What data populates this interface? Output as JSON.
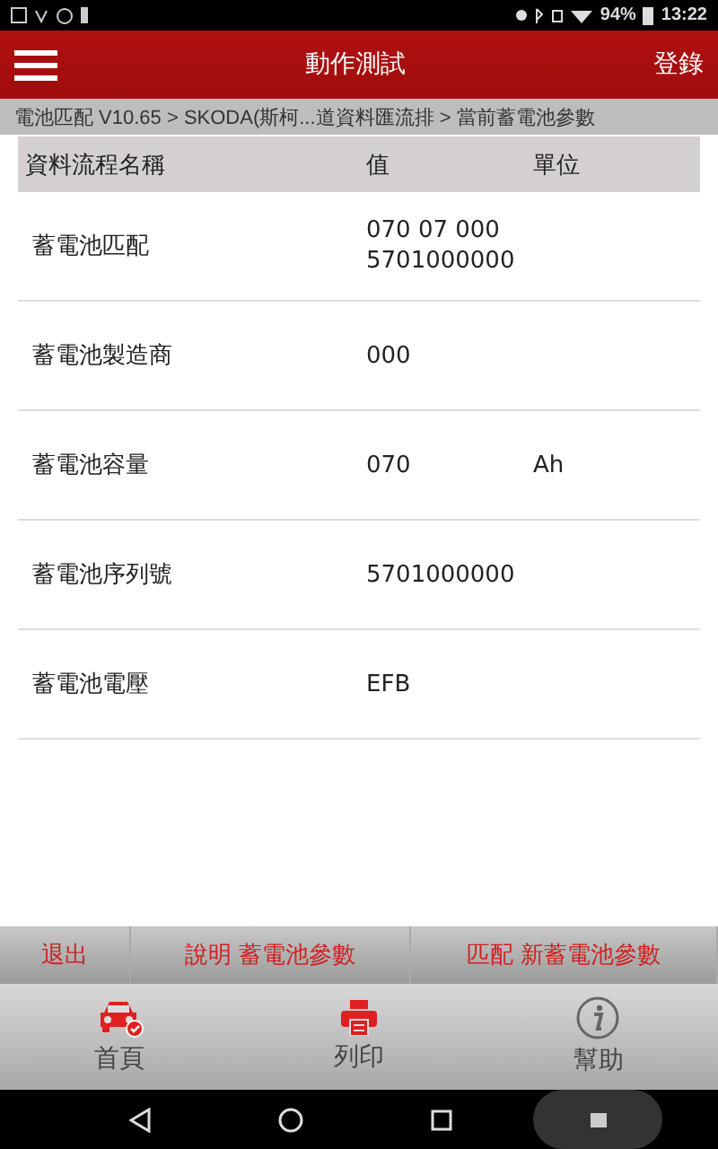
{
  "status_bar": {
    "battery": "94%",
    "time": "13:22"
  },
  "header": {
    "title": "動作測試",
    "action": "登錄"
  },
  "breadcrumb": "電池匹配 V10.65 > SKODA(斯柯...道資料匯流排 > 當前蓄電池參數",
  "table": {
    "columns": [
      "資料流程名稱",
      "值",
      "單位"
    ],
    "rows": [
      {
        "name": "蓄電池匹配",
        "value": [
          "070 07 000",
          "5701000000"
        ],
        "unit": ""
      },
      {
        "name": "蓄電池製造商",
        "value": [
          "000"
        ],
        "unit": ""
      },
      {
        "name": "蓄電池容量",
        "value": [
          "070"
        ],
        "unit": "Ah"
      },
      {
        "name": "蓄電池序列號",
        "value": [
          "5701000000"
        ],
        "unit": ""
      },
      {
        "name": "蓄電池電壓",
        "value": [
          "EFB"
        ],
        "unit": ""
      }
    ]
  },
  "actions": [
    "退出",
    "說明 蓄電池參數",
    "匹配 新蓄電池參數"
  ],
  "nav": [
    {
      "kind": "car",
      "label": "首頁"
    },
    {
      "kind": "printer",
      "label": "列印"
    },
    {
      "kind": "info",
      "label": "幫助"
    }
  ]
}
